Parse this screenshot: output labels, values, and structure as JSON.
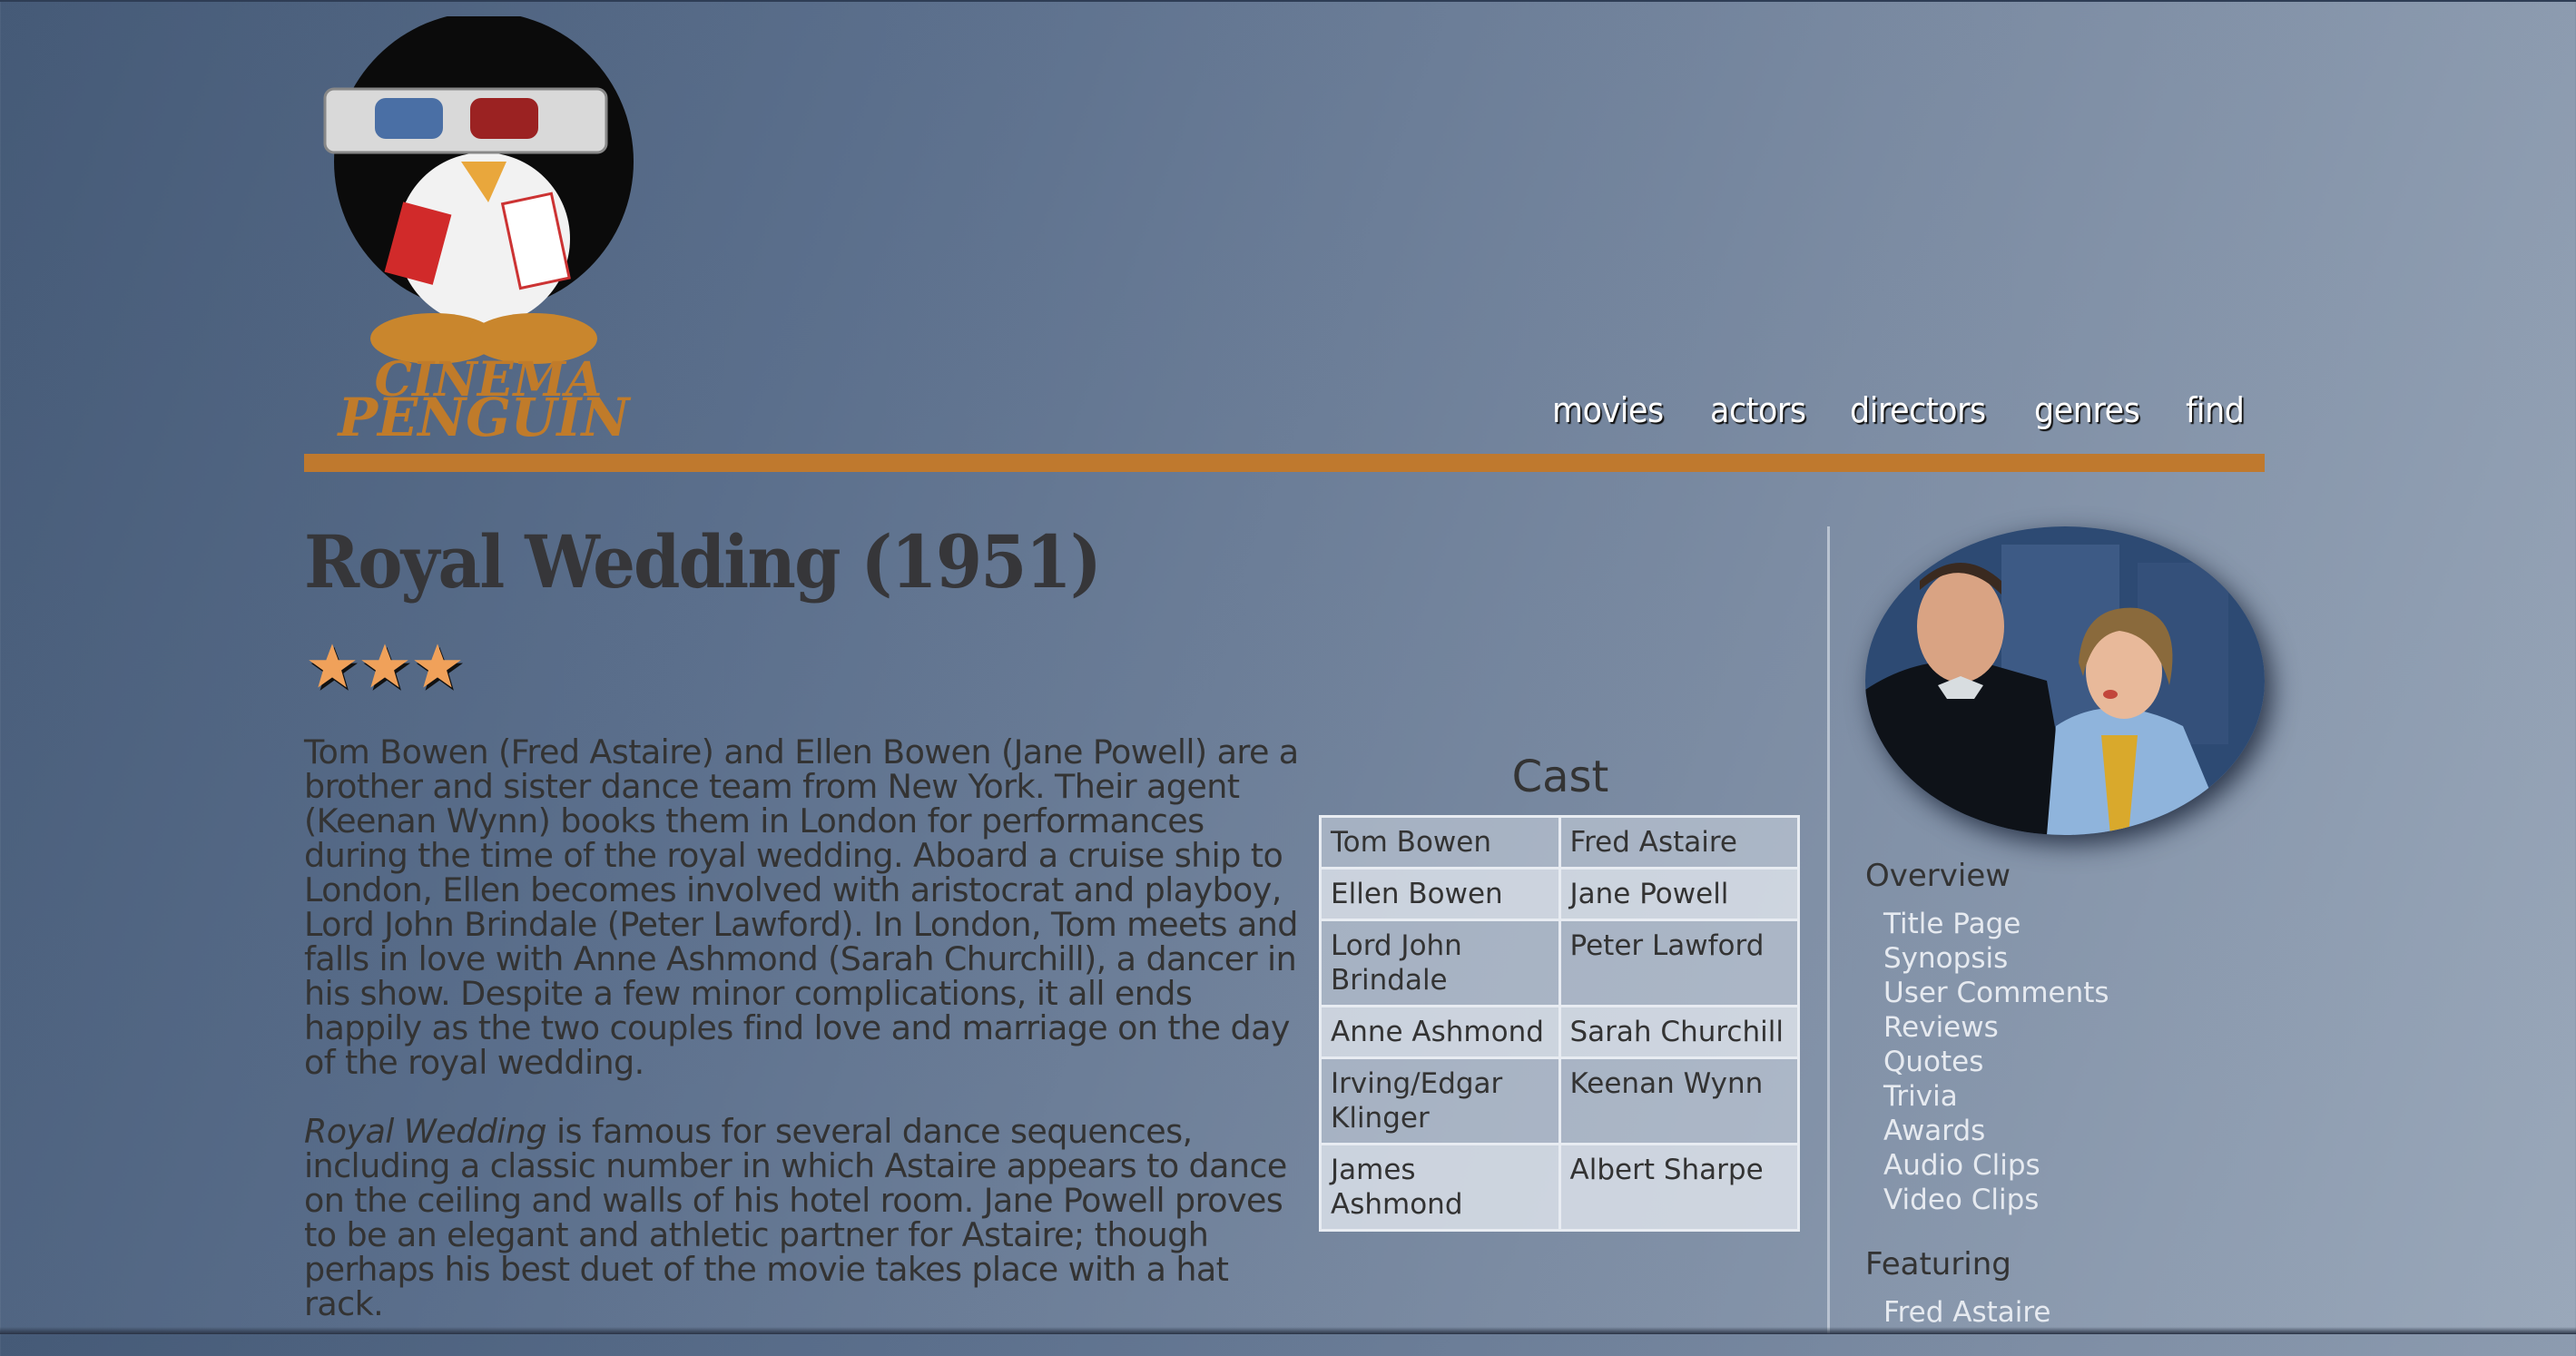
{
  "site": {
    "logo_text_line1": "CINEMA",
    "logo_text_line2": "PENGUIN",
    "brand_color": "#bf792e"
  },
  "nav": {
    "items": [
      {
        "label": "movies"
      },
      {
        "label": "actors"
      },
      {
        "label": "directors"
      },
      {
        "label": "genres"
      },
      {
        "label": "find"
      }
    ]
  },
  "movie": {
    "title": "Royal Wedding (1951)",
    "rating_stars": 3,
    "rating_max": 3,
    "synopsis_p1": "Tom Bowen (Fred Astaire) and Ellen Bowen (Jane Powell) are a brother and sister dance team from New York. Their agent (Keenan Wynn) books them in London for performances during the time of the royal wedding. Aboard a cruise ship to London, Ellen becomes involved with aristocrat and playboy, Lord John Brindale (Peter Lawford). In London, Tom meets and falls in love with Anne Ashmond (Sarah Churchill), a dancer in his show. Despite a few minor complications, it all ends happily as the two couples find love and marriage on the day of the royal wedding.",
    "synopsis_p2_italic": "Royal Wedding",
    "synopsis_p2_rest": " is famous for several dance sequences, including a classic number in which Astaire appears to dance on the ceiling and walls of his hotel room. Jane Powell proves to be an elegant and athletic partner for Astaire; though perhaps his best duet of the movie takes place with a hat rack."
  },
  "cast": {
    "title": "Cast",
    "rows": [
      {
        "role": "Tom Bowen",
        "actor": "Fred Astaire"
      },
      {
        "role": "Ellen Bowen",
        "actor": "Jane Powell"
      },
      {
        "role": "Lord John Brindale",
        "actor": "Peter Lawford"
      },
      {
        "role": "Anne Ashmond",
        "actor": "Sarah Churchill"
      },
      {
        "role": "Irving/Edgar Klinger",
        "actor": "Keenan Wynn"
      },
      {
        "role": "James Ashmond",
        "actor": "Albert Sharpe"
      }
    ]
  },
  "sidebar": {
    "overview_heading": "Overview",
    "overview_links": [
      {
        "label": "Title Page"
      },
      {
        "label": "Synopsis"
      },
      {
        "label": "User Comments"
      },
      {
        "label": "Reviews"
      },
      {
        "label": "Quotes"
      },
      {
        "label": "Trivia"
      },
      {
        "label": "Awards"
      },
      {
        "label": "Audio Clips"
      },
      {
        "label": "Video Clips"
      }
    ],
    "featuring_heading": "Featuring",
    "featuring_links": [
      {
        "label": "Fred Astaire"
      }
    ]
  }
}
